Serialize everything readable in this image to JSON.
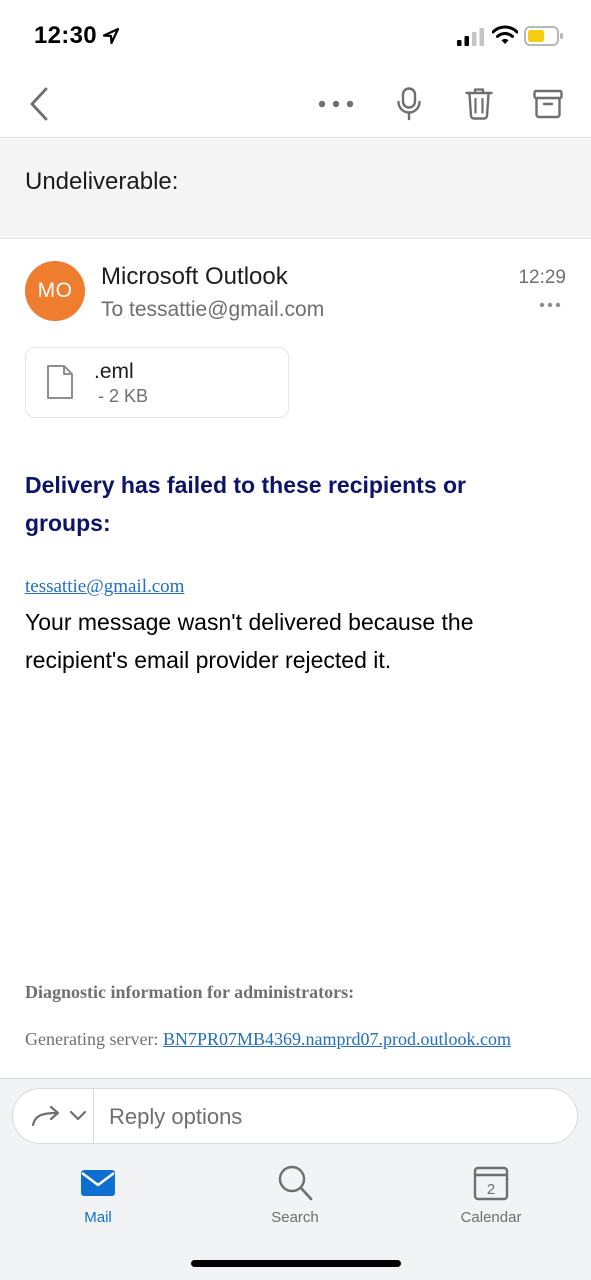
{
  "status_bar": {
    "time": "12:30",
    "battery_color": "#f5cd0f"
  },
  "nav": {
    "icons": [
      "back-chevron-icon",
      "more-icon",
      "microphone-icon",
      "trash-icon",
      "archive-icon"
    ]
  },
  "message": {
    "subject": "Undeliverable:",
    "sender": {
      "initials": "MO",
      "name": "Microsoft Outlook",
      "to": "To tessattie@gmail.com",
      "time": "12:29",
      "avatar_color": "#ef7d2f"
    },
    "attachment": {
      "name": ".eml",
      "size": "- 2 KB"
    },
    "body": {
      "heading": "Delivery has failed to these recipients or groups:",
      "recipient": "tessattie@gmail.com",
      "text": "Your message wasn't delivered because the recipient's email provider rejected it.",
      "diagnostic_heading": "Diagnostic information for administrators:",
      "generating_server_label": "Generating server:",
      "generating_server": "BN7PR07MB4369.namprd07.prod.outlook.com"
    }
  },
  "reply": {
    "placeholder": "Reply options"
  },
  "tabs": [
    {
      "label": "Mail",
      "icon": "mail-icon",
      "active": true,
      "color": "#0f6fd1"
    },
    {
      "label": "Search",
      "icon": "search-icon",
      "active": false,
      "color": "#6e6e73"
    },
    {
      "label": "Calendar",
      "icon": "calendar-icon",
      "active": false,
      "calendar_day": "2",
      "color": "#6e6e73"
    }
  ]
}
